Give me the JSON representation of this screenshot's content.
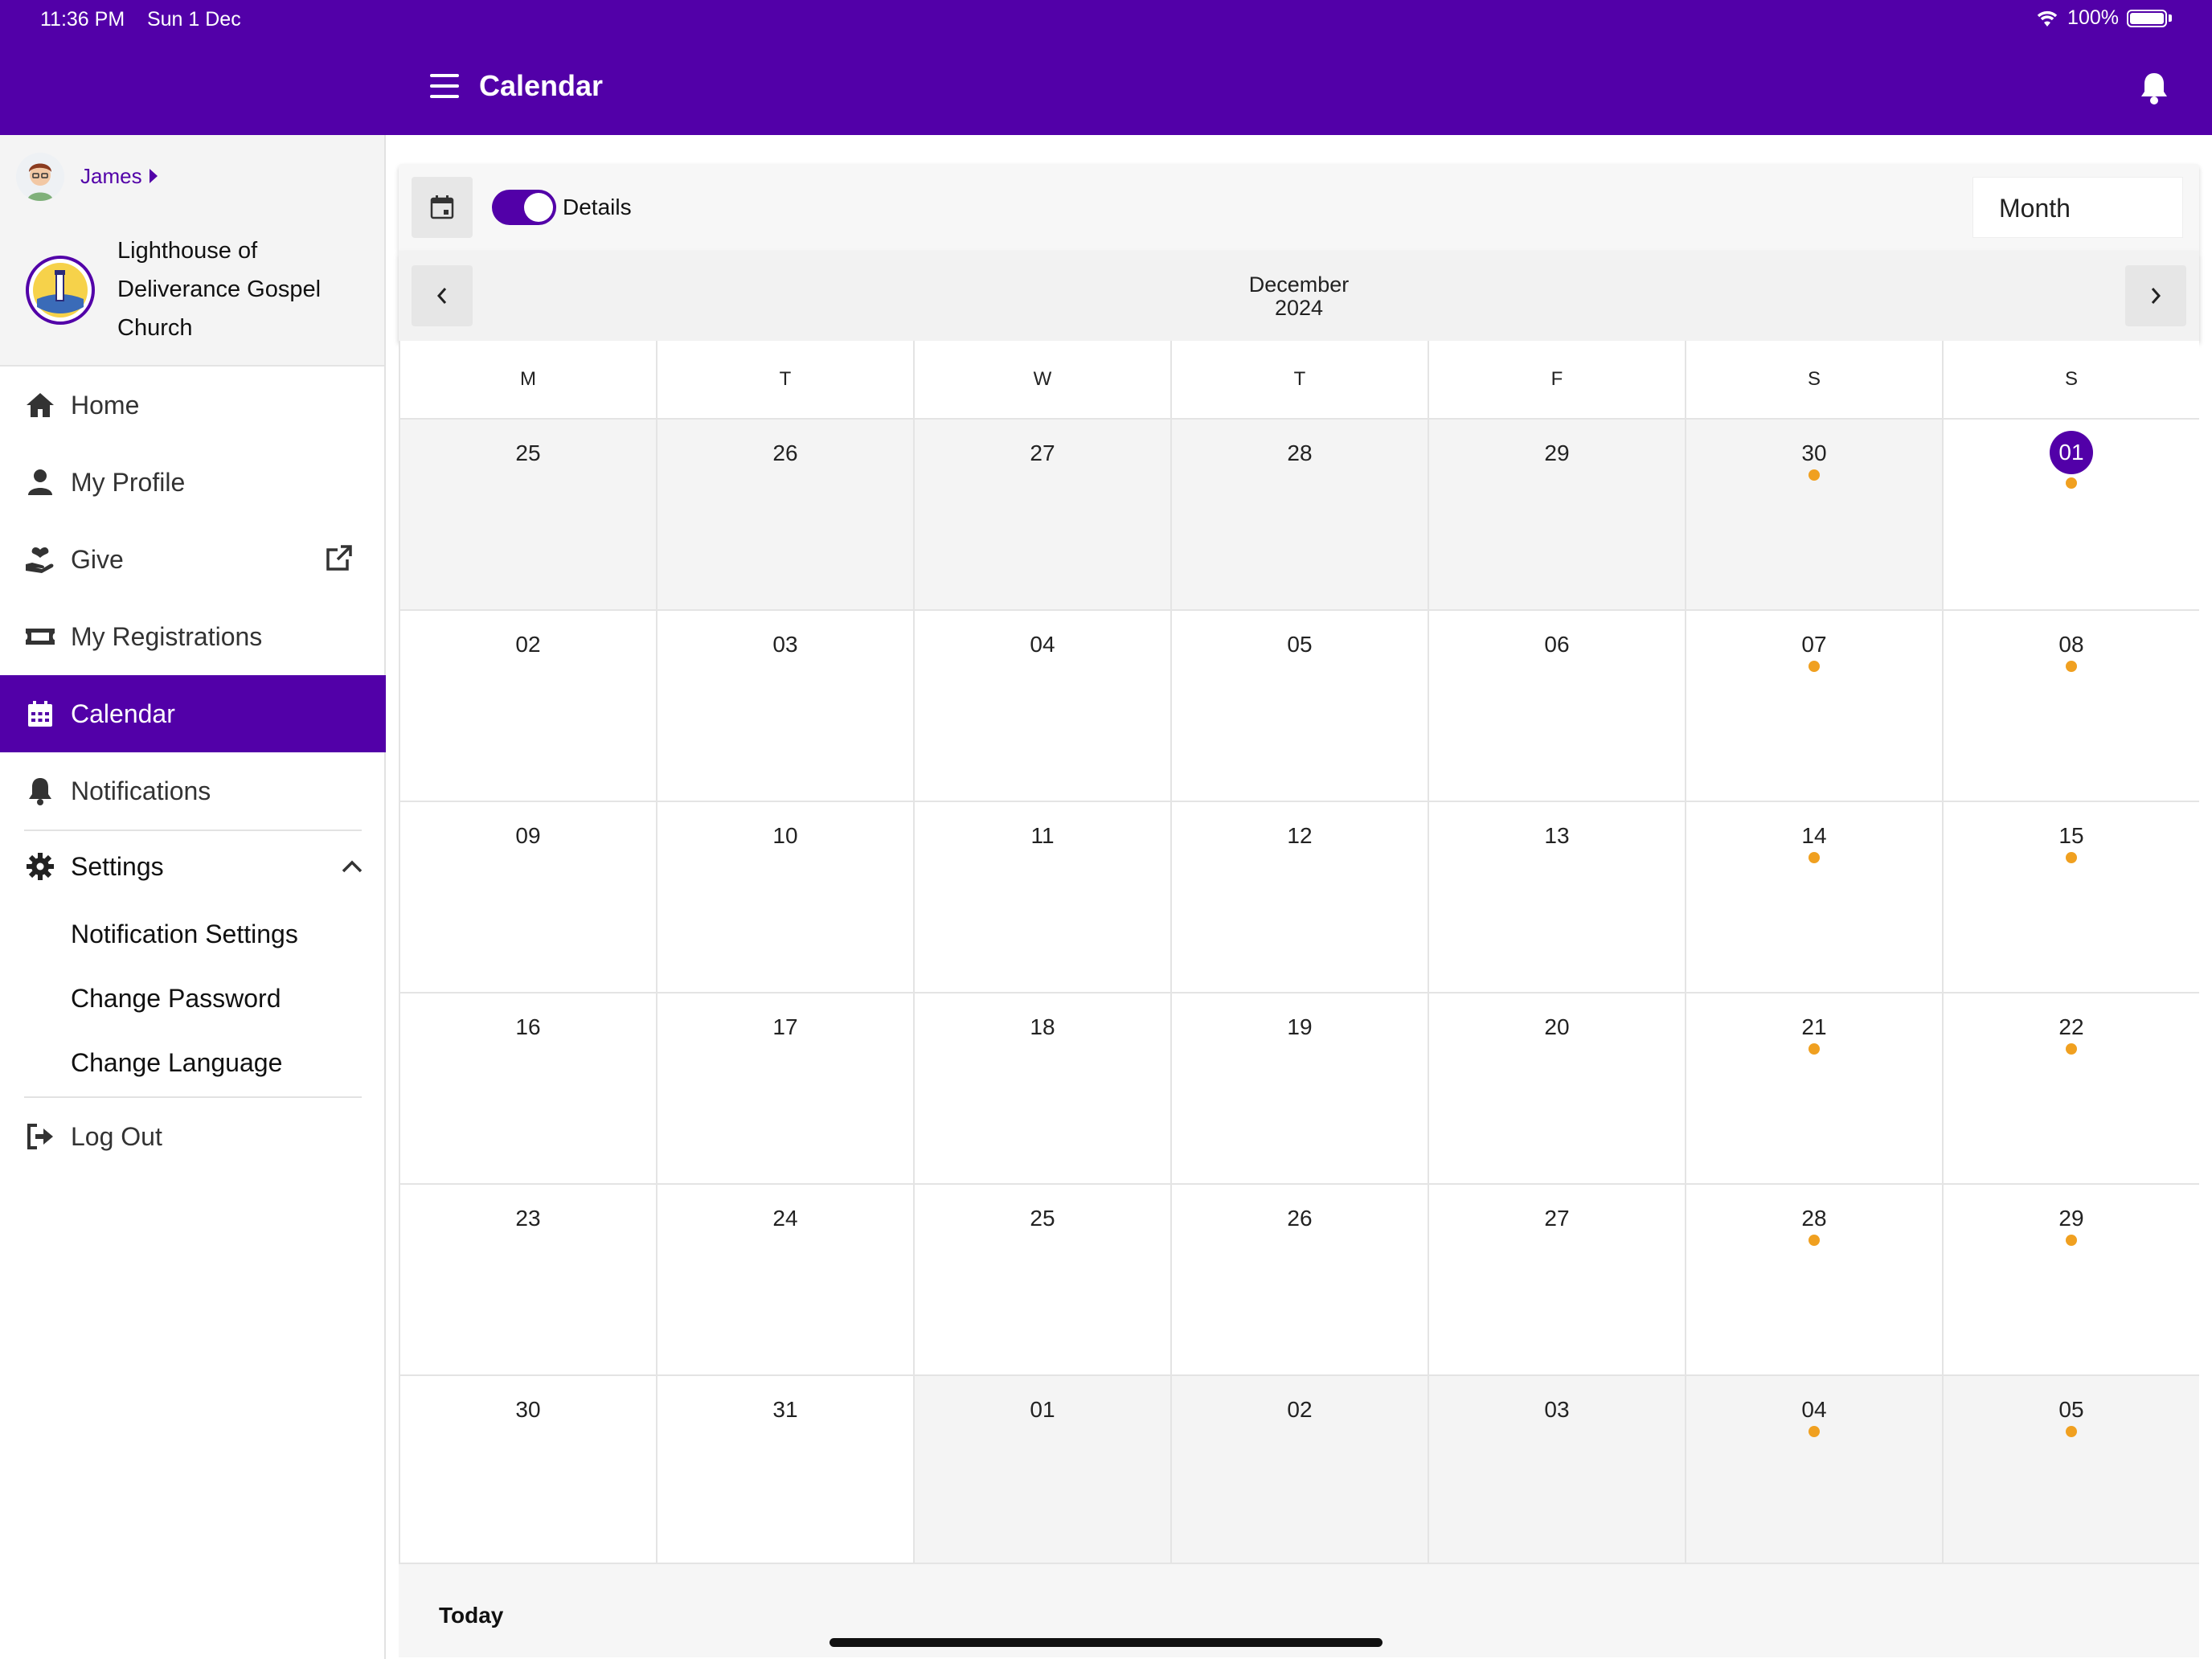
{
  "status": {
    "time": "11:36 PM",
    "date": "Sun 1 Dec",
    "battery": "100%"
  },
  "header": {
    "title": "Calendar"
  },
  "sidebar": {
    "username": "James",
    "church_name": "Lighthouse of Deliverance Gospel Church",
    "items": [
      {
        "label": "Home"
      },
      {
        "label": "My Profile"
      },
      {
        "label": "Give"
      },
      {
        "label": "My Registrations"
      },
      {
        "label": "Calendar"
      },
      {
        "label": "Notifications"
      },
      {
        "label": "Settings"
      }
    ],
    "settings_sub": [
      {
        "label": "Notification Settings"
      },
      {
        "label": "Change Password"
      },
      {
        "label": "Change Language"
      }
    ],
    "logout": "Log Out"
  },
  "toolbar": {
    "details_label": "Details",
    "details_on": true,
    "view": "Month"
  },
  "calendar": {
    "month": "December",
    "year": "2024",
    "days_of_week": [
      "M",
      "T",
      "W",
      "T",
      "F",
      "S",
      "S"
    ],
    "today": "01",
    "weeks": [
      [
        {
          "d": "25",
          "m": true
        },
        {
          "d": "26",
          "m": true
        },
        {
          "d": "27",
          "m": true
        },
        {
          "d": "28",
          "m": true
        },
        {
          "d": "29",
          "m": true
        },
        {
          "d": "30",
          "m": true,
          "e": true
        },
        {
          "d": "01",
          "t": true,
          "e": true
        }
      ],
      [
        {
          "d": "02"
        },
        {
          "d": "03"
        },
        {
          "d": "04"
        },
        {
          "d": "05"
        },
        {
          "d": "06"
        },
        {
          "d": "07",
          "e": true
        },
        {
          "d": "08",
          "e": true
        }
      ],
      [
        {
          "d": "09"
        },
        {
          "d": "10"
        },
        {
          "d": "11"
        },
        {
          "d": "12"
        },
        {
          "d": "13"
        },
        {
          "d": "14",
          "e": true
        },
        {
          "d": "15",
          "e": true
        }
      ],
      [
        {
          "d": "16"
        },
        {
          "d": "17"
        },
        {
          "d": "18"
        },
        {
          "d": "19"
        },
        {
          "d": "20"
        },
        {
          "d": "21",
          "e": true
        },
        {
          "d": "22",
          "e": true
        }
      ],
      [
        {
          "d": "23"
        },
        {
          "d": "24"
        },
        {
          "d": "25"
        },
        {
          "d": "26"
        },
        {
          "d": "27"
        },
        {
          "d": "28",
          "e": true
        },
        {
          "d": "29",
          "e": true
        }
      ],
      [
        {
          "d": "30"
        },
        {
          "d": "31"
        },
        {
          "d": "01",
          "m": true
        },
        {
          "d": "02",
          "m": true
        },
        {
          "d": "03",
          "m": true
        },
        {
          "d": "04",
          "m": true,
          "e": true
        },
        {
          "d": "05",
          "m": true,
          "e": true
        }
      ]
    ]
  },
  "footer": {
    "today_label": "Today"
  },
  "colors": {
    "brand": "#5200a8",
    "event_dot": "#f0a020"
  }
}
